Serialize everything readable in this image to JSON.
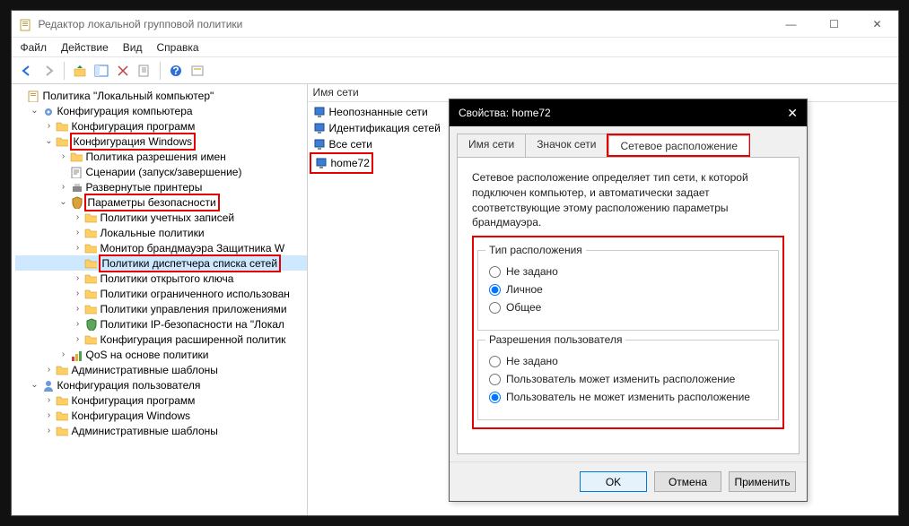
{
  "window": {
    "title": "Редактор локальной групповой политики",
    "controls": {
      "min": "—",
      "max": "☐",
      "close": "✕"
    }
  },
  "menubar": [
    "Файл",
    "Действие",
    "Вид",
    "Справка"
  ],
  "list": {
    "header": "Имя сети",
    "items": [
      {
        "icon": "net-icon",
        "label": "Неопознанные сети"
      },
      {
        "icon": "net-icon",
        "label": "Идентификация сетей"
      },
      {
        "icon": "net-icon",
        "label": "Все сети"
      },
      {
        "icon": "net-icon",
        "label": "home72",
        "highlight": true
      }
    ]
  },
  "tree": [
    {
      "depth": 0,
      "expander": "",
      "icon": "policy-icon",
      "label": "Политика \"Локальный компьютер\""
    },
    {
      "depth": 1,
      "expander": "v",
      "icon": "gear-icon",
      "label": "Конфигурация компьютера"
    },
    {
      "depth": 2,
      "expander": ">",
      "icon": "folder-icon",
      "label": "Конфигурация программ"
    },
    {
      "depth": 2,
      "expander": "v",
      "icon": "folder-icon",
      "label": "Конфигурация Windows",
      "highlight": true
    },
    {
      "depth": 3,
      "expander": ">",
      "icon": "folder-icon",
      "label": "Политика разрешения имен"
    },
    {
      "depth": 3,
      "expander": "",
      "icon": "script-icon",
      "label": "Сценарии (запуск/завершение)"
    },
    {
      "depth": 3,
      "expander": ">",
      "icon": "printer-icon",
      "label": "Развернутые принтеры"
    },
    {
      "depth": 3,
      "expander": "v",
      "icon": "security-icon",
      "label": "Параметры безопасности",
      "highlight": true
    },
    {
      "depth": 4,
      "expander": ">",
      "icon": "folder-icon",
      "label": "Политики учетных записей"
    },
    {
      "depth": 4,
      "expander": ">",
      "icon": "folder-icon",
      "label": "Локальные политики"
    },
    {
      "depth": 4,
      "expander": ">",
      "icon": "folder-icon",
      "label": "Монитор брандмауэра Защитника W"
    },
    {
      "depth": 4,
      "expander": "",
      "icon": "folder-icon",
      "label": "Политики диспетчера списка сетей",
      "highlight": true,
      "selected": true
    },
    {
      "depth": 4,
      "expander": ">",
      "icon": "folder-icon",
      "label": "Политики открытого ключа"
    },
    {
      "depth": 4,
      "expander": ">",
      "icon": "folder-icon",
      "label": "Политики ограниченного использован"
    },
    {
      "depth": 4,
      "expander": ">",
      "icon": "folder-icon",
      "label": "Политики управления приложениями"
    },
    {
      "depth": 4,
      "expander": ">",
      "icon": "shield-icon",
      "label": "Политики IP-безопасности на \"Локал"
    },
    {
      "depth": 4,
      "expander": ">",
      "icon": "folder-icon",
      "label": "Конфигурация расширенной политик"
    },
    {
      "depth": 3,
      "expander": ">",
      "icon": "qos-icon",
      "label": "QoS на основе политики"
    },
    {
      "depth": 2,
      "expander": ">",
      "icon": "folder-icon",
      "label": "Административные шаблоны"
    },
    {
      "depth": 1,
      "expander": "v",
      "icon": "user-icon",
      "label": "Конфигурация пользователя"
    },
    {
      "depth": 2,
      "expander": ">",
      "icon": "folder-icon",
      "label": "Конфигурация программ"
    },
    {
      "depth": 2,
      "expander": ">",
      "icon": "folder-icon",
      "label": "Конфигурация Windows"
    },
    {
      "depth": 2,
      "expander": ">",
      "icon": "folder-icon",
      "label": "Административные шаблоны"
    }
  ],
  "dialog": {
    "title": "Свойства: home72",
    "tabs": [
      "Имя сети",
      "Значок сети",
      "Сетевое расположение"
    ],
    "active_tab": 2,
    "description": "Сетевое расположение определяет тип сети, к которой подключен компьютер, и автоматически задает соответствующие этому расположению параметры брандмауэра.",
    "group1": {
      "title": "Тип расположения",
      "options": [
        "Не задано",
        "Личное",
        "Общее"
      ],
      "selected": 1
    },
    "group2": {
      "title": "Разрешения пользователя",
      "options": [
        "Не задано",
        "Пользователь может изменить расположение",
        "Пользователь не может изменить расположение"
      ],
      "selected": 2
    },
    "buttons": {
      "ok": "OK",
      "cancel": "Отмена",
      "apply": "Применить"
    }
  }
}
